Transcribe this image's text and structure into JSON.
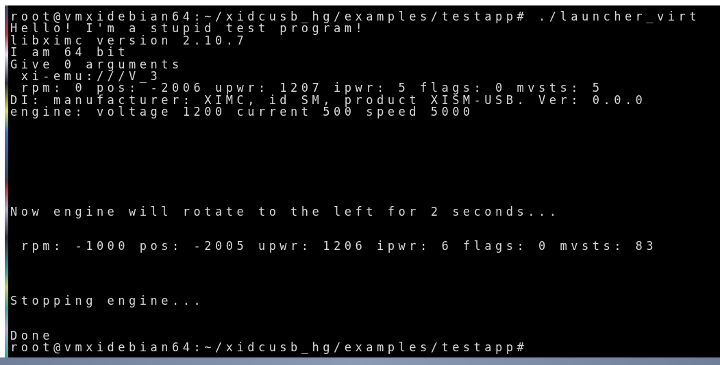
{
  "terminal": {
    "blocks": [
      [
        "root@vmxidebian64:~/xidcusb_hg/examples/testapp# ./launcher_virt",
        "Hello! I'm a stupid test program!",
        "libximc version 2.10.7",
        "I am 64 bit",
        "Give 0 arguments",
        " xi-emu:///V_3",
        " rpm: 0 pos: -2006 upwr: 1207 ipwr: 5 flags: 0 mvsts: 5",
        "DI: manufacturer: XIMC, id SM, product XISM-USB. Ver: 0.0.0",
        "engine: voltage 1200 current 500 speed 5000"
      ],
      [
        "Now engine will rotate to the left for 2 seconds..."
      ],
      [
        " rpm: -1000 pos: -2005 upwr: 1206 ipwr: 6 flags: 0 mvsts: 83"
      ],
      [
        "Stopping engine..."
      ],
      [
        "Done",
        "root@vmxidebian64:~/xidcusb_hg/examples/testapp#"
      ]
    ]
  }
}
